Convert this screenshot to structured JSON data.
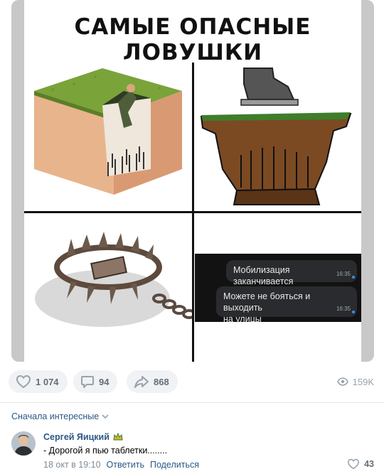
{
  "meme": {
    "title": "САМЫЕ ОПАСНЫЕ ЛОВУШКИ",
    "chat": {
      "messages": [
        {
          "text": "Мобилизация заканчивается",
          "time": "16:35"
        },
        {
          "text_line1": "Можете не бояться и выходить",
          "text_line2": "на улицы",
          "time": "16:35"
        }
      ]
    }
  },
  "actions": {
    "likes": "1 074",
    "comments": "94",
    "shares": "868",
    "views": "159K"
  },
  "comments_section": {
    "sort_label": "Сначала интересные",
    "items": [
      {
        "author": "Сергей Яицкий",
        "text": "- Дорогой я пью таблетки........",
        "date": "18 окт в 19:10",
        "reply_label": "Ответить",
        "share_label": "Поделиться",
        "likes": "43"
      }
    ]
  },
  "colors": {
    "accent": "#2a5885",
    "icon_gray": "#99a2ad",
    "pill_bg": "#f0f2f5"
  }
}
